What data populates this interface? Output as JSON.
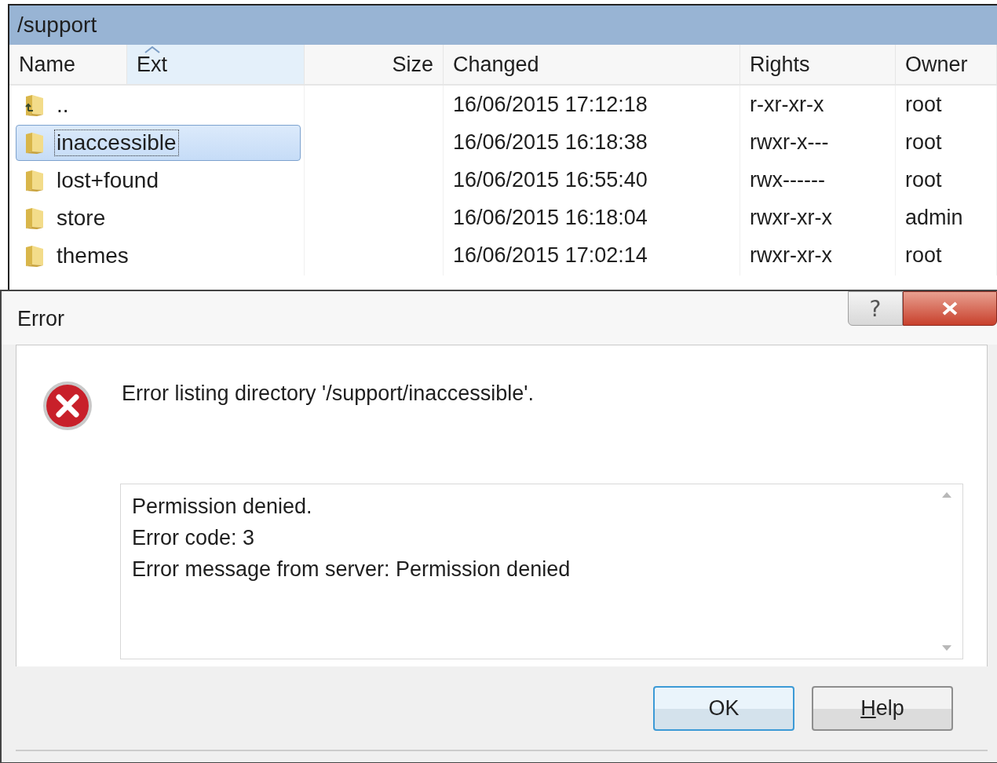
{
  "panel": {
    "path": "/support",
    "columns": [
      {
        "label": "Name",
        "sorted": false
      },
      {
        "label": "Ext",
        "sorted": true
      },
      {
        "label": "Size",
        "sorted": false
      },
      {
        "label": "Changed",
        "sorted": false
      },
      {
        "label": "Rights",
        "sorted": false
      },
      {
        "label": "Owner",
        "sorted": false
      }
    ],
    "rows": [
      {
        "kind": "parent",
        "name": "..",
        "changed": "16/06/2015 17:12:18",
        "rights": "r-xr-xr-x",
        "owner": "root",
        "selected": false
      },
      {
        "kind": "folder",
        "name": "inaccessible",
        "changed": "16/06/2015 16:18:38",
        "rights": "rwxr-x---",
        "owner": "root",
        "selected": true
      },
      {
        "kind": "folder",
        "name": "lost+found",
        "changed": "16/06/2015 16:55:40",
        "rights": "rwx------",
        "owner": "root",
        "selected": false
      },
      {
        "kind": "folder",
        "name": "store",
        "changed": "16/06/2015 16:18:04",
        "rights": "rwxr-xr-x",
        "owner": "admin",
        "selected": false
      },
      {
        "kind": "folder",
        "name": "themes",
        "changed": "16/06/2015 17:02:14",
        "rights": "rwxr-xr-x",
        "owner": "root",
        "selected": false
      }
    ]
  },
  "dialog": {
    "title": "Error",
    "help_glyph": "?",
    "message": "Error listing directory '/support/inaccessible'.",
    "details": [
      "Permission denied.",
      "Error code: 3",
      "Error message from server: Permission denied"
    ],
    "buttons": [
      {
        "label": "OK",
        "default": true
      },
      {
        "label": "Help",
        "default": false,
        "first_letter_underlined": true
      }
    ]
  }
}
